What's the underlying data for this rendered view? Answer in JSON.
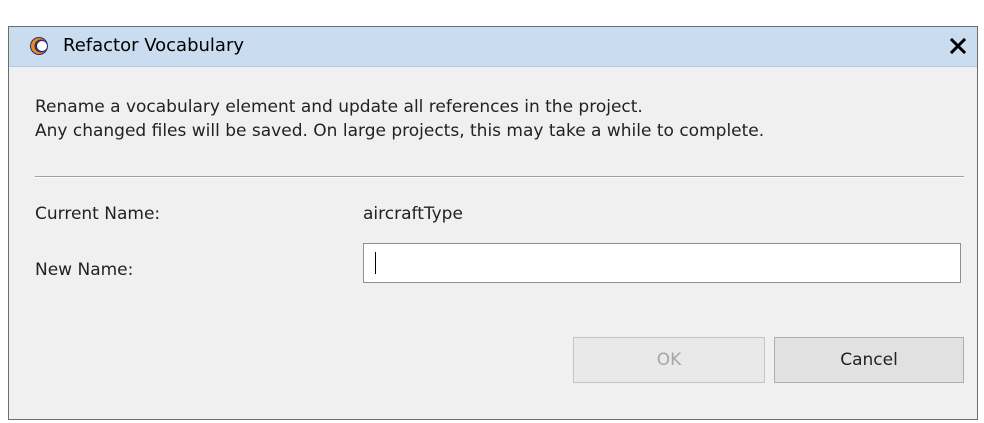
{
  "window": {
    "title": "Refactor Vocabulary",
    "close_label": "close"
  },
  "description": {
    "line1": "Rename a vocabulary element and update all references in the project.",
    "line2": "Any changed files will be saved. On large projects, this may take a while to complete."
  },
  "form": {
    "current_name_label": "Current Name:",
    "current_name_value": "aircraftType",
    "new_name_label": "New Name:",
    "new_name_value": ""
  },
  "buttons": {
    "ok_label": "OK",
    "ok_enabled": false,
    "cancel_label": "Cancel"
  },
  "colors": {
    "titlebar": "#c9dcf0",
    "dialog_bg": "#f0f0f0",
    "disabled_text": "#a6a6a6"
  },
  "icons": {
    "app": "eclipse-app-icon",
    "close": "close-icon"
  }
}
